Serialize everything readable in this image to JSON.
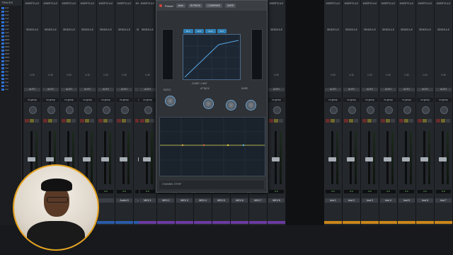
{
  "tracks_panel": {
    "header": "TRACKS",
    "rows": [
      "Aud",
      "Aud",
      "Aud",
      "Aud",
      "Aud",
      "Aud",
      "Aud",
      "Aud",
      "MIDI",
      "MIDI",
      "MIDI",
      "MIDI",
      "MIDI",
      "MIDI",
      "MIDI",
      "MIDI",
      "Inst",
      "Inst",
      "Inst",
      "Inst",
      "Inst",
      "Inst",
      "Inst",
      "Inst"
    ]
  },
  "strips": [
    {
      "name": "",
      "vol": "0.0",
      "color": "#2a5aa8"
    },
    {
      "name": "",
      "vol": "0.0",
      "color": "#2a5aa8"
    },
    {
      "name": "",
      "vol": "0.0",
      "color": "#2a5aa8"
    },
    {
      "name": "",
      "vol": "0.0",
      "color": "#2a5aa8"
    },
    {
      "name": "",
      "vol": "0.0",
      "color": "#2a5aa8"
    },
    {
      "name": "Audio 5",
      "vol": "0.0",
      "color": "#2a5aa8"
    },
    {
      "name": "Audio 6",
      "vol": "0.0",
      "color": "#2a5aa8"
    },
    {
      "name": "Audio 7",
      "vol": "0.0",
      "color": "#2a5aa8"
    },
    {
      "name": "MIDI 1",
      "vol": "0.0",
      "color": "#6b3aa0"
    },
    {
      "name": "MIDI 2",
      "vol": "0.0",
      "color": "#6b3aa0"
    },
    {
      "name": "MIDI 3",
      "vol": "0.0",
      "color": "#6b3aa0"
    },
    {
      "name": "MIDI 4",
      "vol": "0.0",
      "color": "#6b3aa0"
    },
    {
      "name": "MIDI 5",
      "vol": "0.0",
      "color": "#6b3aa0"
    },
    {
      "name": "MIDI 6",
      "vol": "0.0",
      "color": "#6b3aa0"
    },
    {
      "name": "MIDI 7",
      "vol": "0.0",
      "color": "#6b3aa0"
    },
    {
      "name": "MIDI 8",
      "vol": "0.0",
      "color": "#6b3aa0"
    },
    {
      "name": "Inst 1",
      "vol": "0.0",
      "color": "#c9871a"
    },
    {
      "name": "Inst 2",
      "vol": "0.0",
      "color": "#c9871a"
    },
    {
      "name": "Inst 3",
      "vol": "0.0",
      "color": "#c9871a"
    },
    {
      "name": "Inst 4",
      "vol": "0.0",
      "color": "#c9871a"
    },
    {
      "name": "Inst 5",
      "vol": "0.0",
      "color": "#c9871a"
    },
    {
      "name": "Inst 6",
      "vol": "0.0",
      "color": "#c9871a"
    },
    {
      "name": "Inst 7",
      "vol": "0.0",
      "color": "#c9871a"
    }
  ],
  "strip_labels": {
    "inserts": "INSERTS A-E",
    "sends": "SENDS A-E",
    "io": "I / O",
    "auto": "AUTO",
    "group": "no group",
    "pan": "pan"
  },
  "plugin": {
    "preset_label": "Preset",
    "auto_label": "Auto",
    "bypass": "BYPASS",
    "compare": "COMPARE",
    "safe": "SAFE",
    "tabs": [
      "Gt 1",
      "Gt 2",
      "Cmp",
      "Lmt"
    ],
    "comp_section": "COMP / LIMIT",
    "knob_labels": [
      "RATIO",
      "ATTACK",
      "KNEE",
      "RELEASE",
      "THRESH",
      "GAIN"
    ],
    "footer": "CHANNEL STRIP"
  }
}
